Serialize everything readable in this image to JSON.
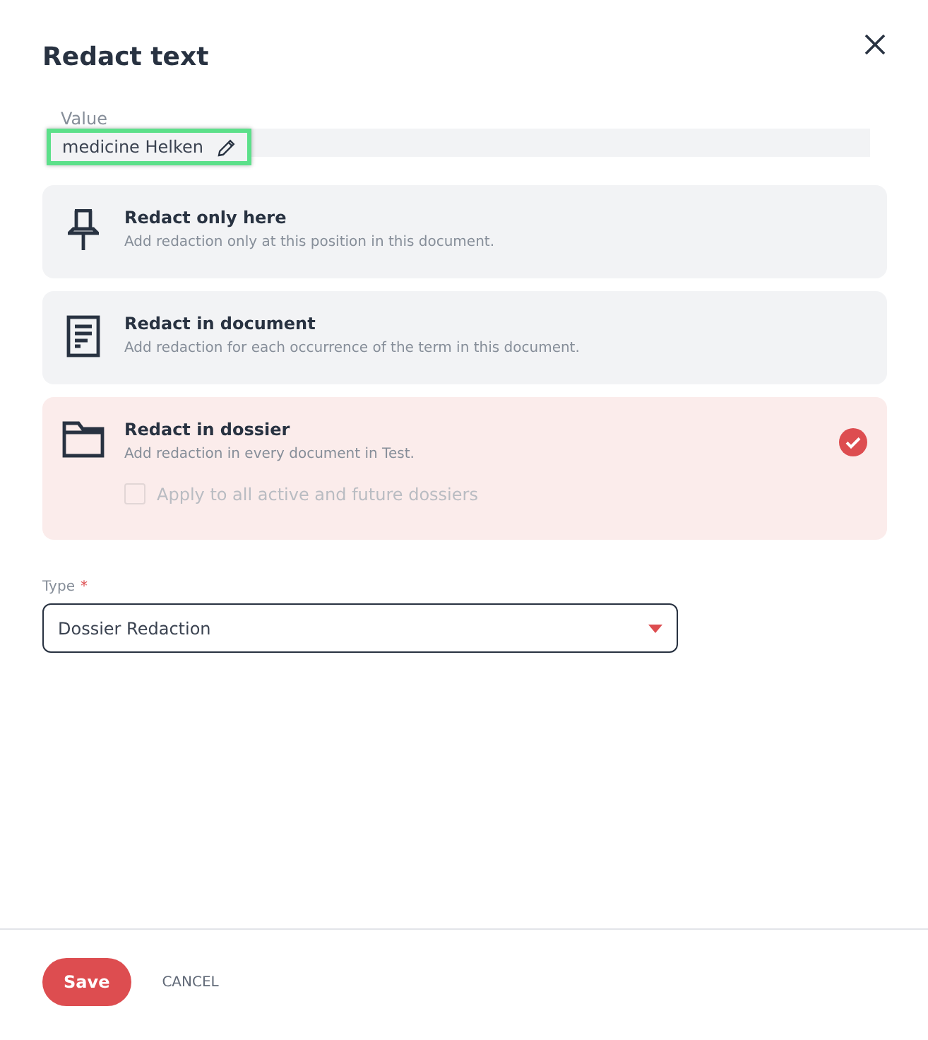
{
  "dialog": {
    "title": "Redact text"
  },
  "value": {
    "label": "Value",
    "text": "medicine Helken"
  },
  "options": [
    {
      "kind": "pin",
      "title": "Redact only here",
      "description": "Add redaction only at this position in this document.",
      "selected": false
    },
    {
      "kind": "document",
      "title": "Redact in document",
      "description": "Add redaction for each occurrence of the term in this document.",
      "selected": false
    },
    {
      "kind": "folder",
      "title": "Redact in dossier",
      "description": "Add redaction in every document in Test.",
      "selected": true,
      "checkbox": {
        "label": "Apply to all active and future dossiers",
        "checked": false,
        "disabled": true
      }
    }
  ],
  "type_field": {
    "label": "Type",
    "required_mark": "*",
    "value": "Dossier Redaction"
  },
  "buttons": [
    {
      "kind": "primary",
      "label": "Save"
    },
    {
      "kind": "text",
      "label": "CANCEL"
    }
  ]
}
